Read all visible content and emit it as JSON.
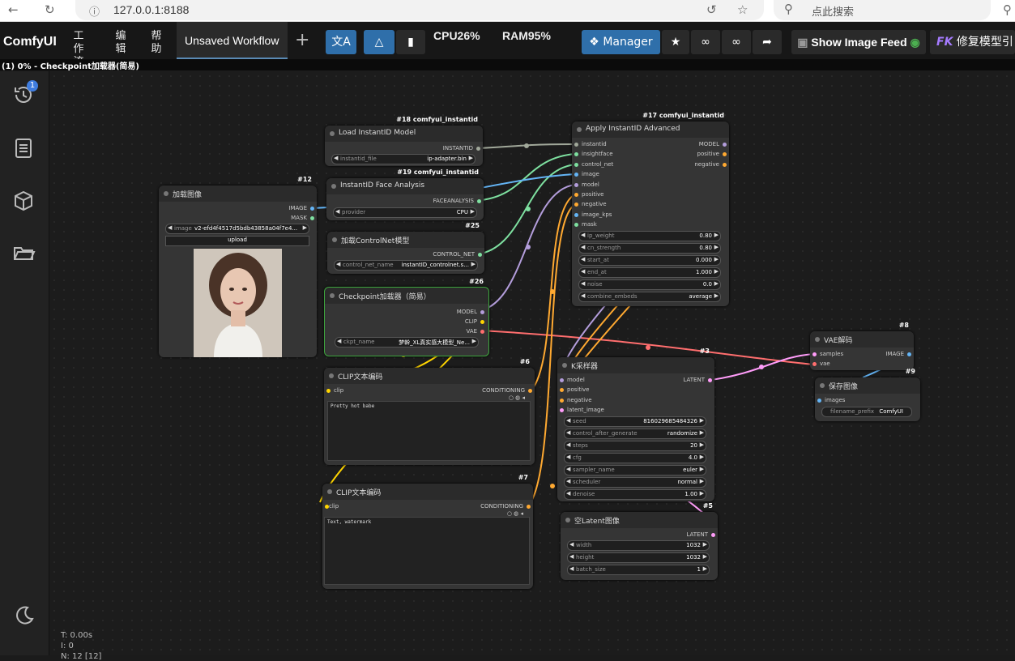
{
  "browser": {
    "url": "127.0.0.1:8188",
    "search_placeholder": "点此搜索"
  },
  "app": {
    "logo": "ComfyUI",
    "menu": [
      "工作流",
      "编辑",
      "帮助"
    ],
    "tab_title": "Unsaved Workflow",
    "cpu": "CPU26%",
    "ram": "RAM95%",
    "manager_label": "Manager",
    "show_image_feed": "Show Image Feed",
    "fix_model": "修复模型引",
    "fk_badge": "FK"
  },
  "status": "(1) 0% - Checkpoint加载器(简易)",
  "sidebar": {
    "history_badge": "1"
  },
  "footer": {
    "t": "T: 0.00s",
    "i": "I: 0",
    "n": "N: 12 [12]"
  },
  "nodes": {
    "load_image": {
      "id": "#12",
      "title": "加载图像",
      "out1": "IMAGE",
      "out2": "MASK",
      "image_label": "image",
      "image_value": "v2-efd4f4517d5bdb43858a04f7e4...",
      "upload": "upload"
    },
    "load_instantid": {
      "id": "#18 comfyui_instantid",
      "title": "Load InstantID Model",
      "out": "INSTANTID",
      "w_label": "instantid_file",
      "w_value": "ip-adapter.bin"
    },
    "face_analysis": {
      "id": "#19 comfyui_instantid",
      "title": "InstantID Face Analysis",
      "out": "FACEANALYSIS",
      "w_label": "provider",
      "w_value": "CPU"
    },
    "controlnet": {
      "id": "#25",
      "title": "加载ControlNet模型",
      "out": "CONTROL_NET",
      "w_label": "control_net_name",
      "w_value": "instantID_controlnet.s..."
    },
    "checkpoint": {
      "id": "#26",
      "title": "Checkpoint加载器（简易）",
      "out1": "MODEL",
      "out2": "CLIP",
      "out3": "VAE",
      "w_label": "ckpt_name",
      "w_value": "梦幹_XL真实感大模型_Ne..."
    },
    "clip_pos": {
      "id": "#6",
      "title": "CLIP文本编码",
      "in": "clip",
      "out": "CONDITIONING",
      "text": "Pretty hot babe"
    },
    "clip_neg": {
      "id": "#7",
      "title": "CLIP文本编码",
      "in": "clip",
      "out": "CONDITIONING",
      "text": "Text, watermark"
    },
    "apply_instantid": {
      "id": "#17 comfyui_instantid",
      "title": "Apply InstantID Advanced",
      "inputs": [
        "instantid",
        "insightface",
        "control_net",
        "image",
        "model",
        "positive",
        "negative",
        "image_kps",
        "mask"
      ],
      "outputs": [
        "MODEL",
        "positive",
        "negative"
      ],
      "widgets": [
        {
          "label": "ip_weight",
          "value": "0.80"
        },
        {
          "label": "cn_strength",
          "value": "0.80"
        },
        {
          "label": "start_at",
          "value": "0.000"
        },
        {
          "label": "end_at",
          "value": "1.000"
        },
        {
          "label": "noise",
          "value": "0.0"
        },
        {
          "label": "combine_embeds",
          "value": "average"
        }
      ]
    },
    "ksampler": {
      "id": "#3",
      "title": "K采样器",
      "inputs": [
        "model",
        "positive",
        "negative",
        "latent_image"
      ],
      "out": "LATENT",
      "widgets": [
        {
          "label": "seed",
          "value": "816029685484326"
        },
        {
          "label": "control_after_generate",
          "value": "randomize"
        },
        {
          "label": "steps",
          "value": "20"
        },
        {
          "label": "cfg",
          "value": "4.0"
        },
        {
          "label": "sampler_name",
          "value": "euler"
        },
        {
          "label": "scheduler",
          "value": "normal"
        },
        {
          "label": "denoise",
          "value": "1.00"
        }
      ]
    },
    "empty_latent": {
      "id": "#5",
      "title": "空Latent图像",
      "out": "LATENT",
      "widgets": [
        {
          "label": "width",
          "value": "1032"
        },
        {
          "label": "height",
          "value": "1032"
        },
        {
          "label": "batch_size",
          "value": "1"
        }
      ]
    },
    "vae_decode": {
      "id": "#8",
      "title": "VAE解码",
      "in1": "samples",
      "in2": "vae",
      "out": "IMAGE"
    },
    "save_image": {
      "id": "#9",
      "title": "保存图像",
      "in": "images",
      "w_label": "filename_prefix",
      "w_value": "ComfyUI"
    }
  },
  "colors": {
    "model": "#b39ddb",
    "clip": "#ffd500",
    "vae": "#ff6e6e",
    "conditioning": "#ffa931",
    "latent": "#ff9cf9",
    "image": "#64b5f6",
    "instantid": "#a1a89a",
    "green": "#7ee0a0"
  }
}
